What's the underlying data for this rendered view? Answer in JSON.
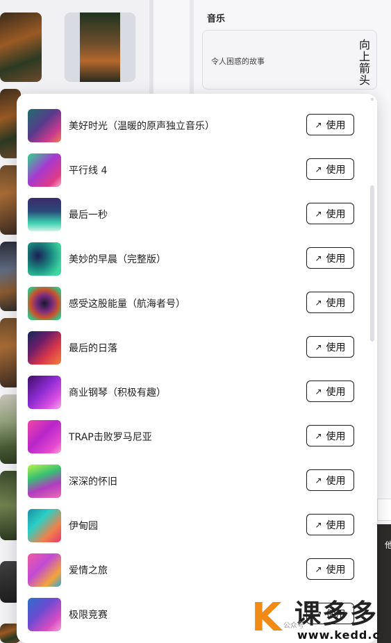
{
  "right_panel": {
    "title": "音乐",
    "current_track": "令人困惑的故事",
    "vertical_label": "向上箭头"
  },
  "side_text": "他",
  "dropdown": {
    "use_label": "使用",
    "use_icon": "arrow-up-right-icon",
    "tracks": [
      {
        "name": "美好时光（温暖的原声独立音乐）"
      },
      {
        "name": "平行线 4"
      },
      {
        "name": "最后一秒"
      },
      {
        "name": "美妙的早晨（完整版）"
      },
      {
        "name": "感受这股能量（航海者号）"
      },
      {
        "name": "最后的日落"
      },
      {
        "name": "商业钢琴（积极有趣）"
      },
      {
        "name": "TRAP击败罗马尼亚"
      },
      {
        "name": "深深的怀旧"
      },
      {
        "name": "伊甸园"
      },
      {
        "name": "爱情之旅"
      },
      {
        "name": "极限竞赛"
      }
    ]
  },
  "watermark": {
    "logo_letter": "K",
    "brand": "课多多",
    "url": "www.kedd.c",
    "sub": "公众号"
  }
}
